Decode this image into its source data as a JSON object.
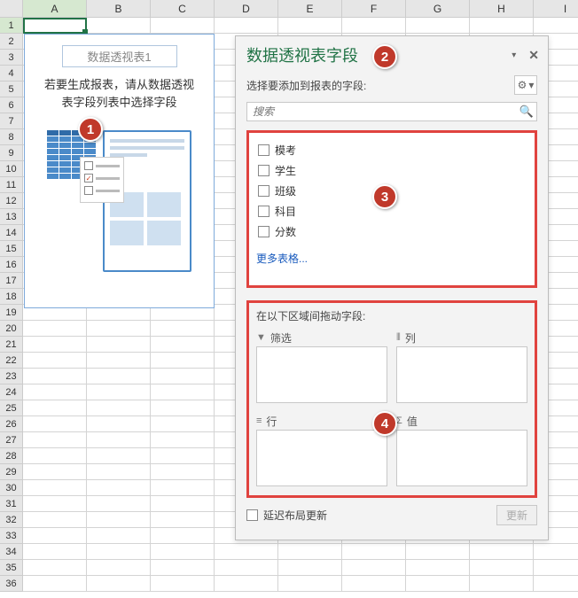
{
  "grid": {
    "columns": [
      "A",
      "B",
      "C",
      "D",
      "E",
      "F",
      "G",
      "H",
      "I"
    ],
    "row_count": 36,
    "active_cell": "A1",
    "active_col_index": 0,
    "active_row_index": 0
  },
  "pivot_placeholder": {
    "title": "数据透视表1",
    "message_line1": "若要生成报表，请从数据透视",
    "message_line2": "表字段列表中选择字段"
  },
  "pane": {
    "title": "数据透视表字段",
    "subtitle": "选择要添加到报表的字段:",
    "search_placeholder": "搜索",
    "fields": [
      "模考",
      "学生",
      "班级",
      "科目",
      "分数"
    ],
    "more_tables": "更多表格...",
    "areas_label": "在以下区域间拖动字段:",
    "areas": {
      "filter": "筛选",
      "columns": "列",
      "rows": "行",
      "values": "值"
    },
    "defer_label": "延迟布局更新",
    "update_button": "更新"
  },
  "badges": {
    "b1": "1",
    "b2": "2",
    "b3": "3",
    "b4": "4"
  },
  "icons": {
    "gear": "⚙",
    "caret": "▾",
    "close": "✕",
    "search": "🔍",
    "filter": "▼",
    "cols": "⦀",
    "rows": "≡",
    "values": "Σ",
    "check": "✓"
  }
}
